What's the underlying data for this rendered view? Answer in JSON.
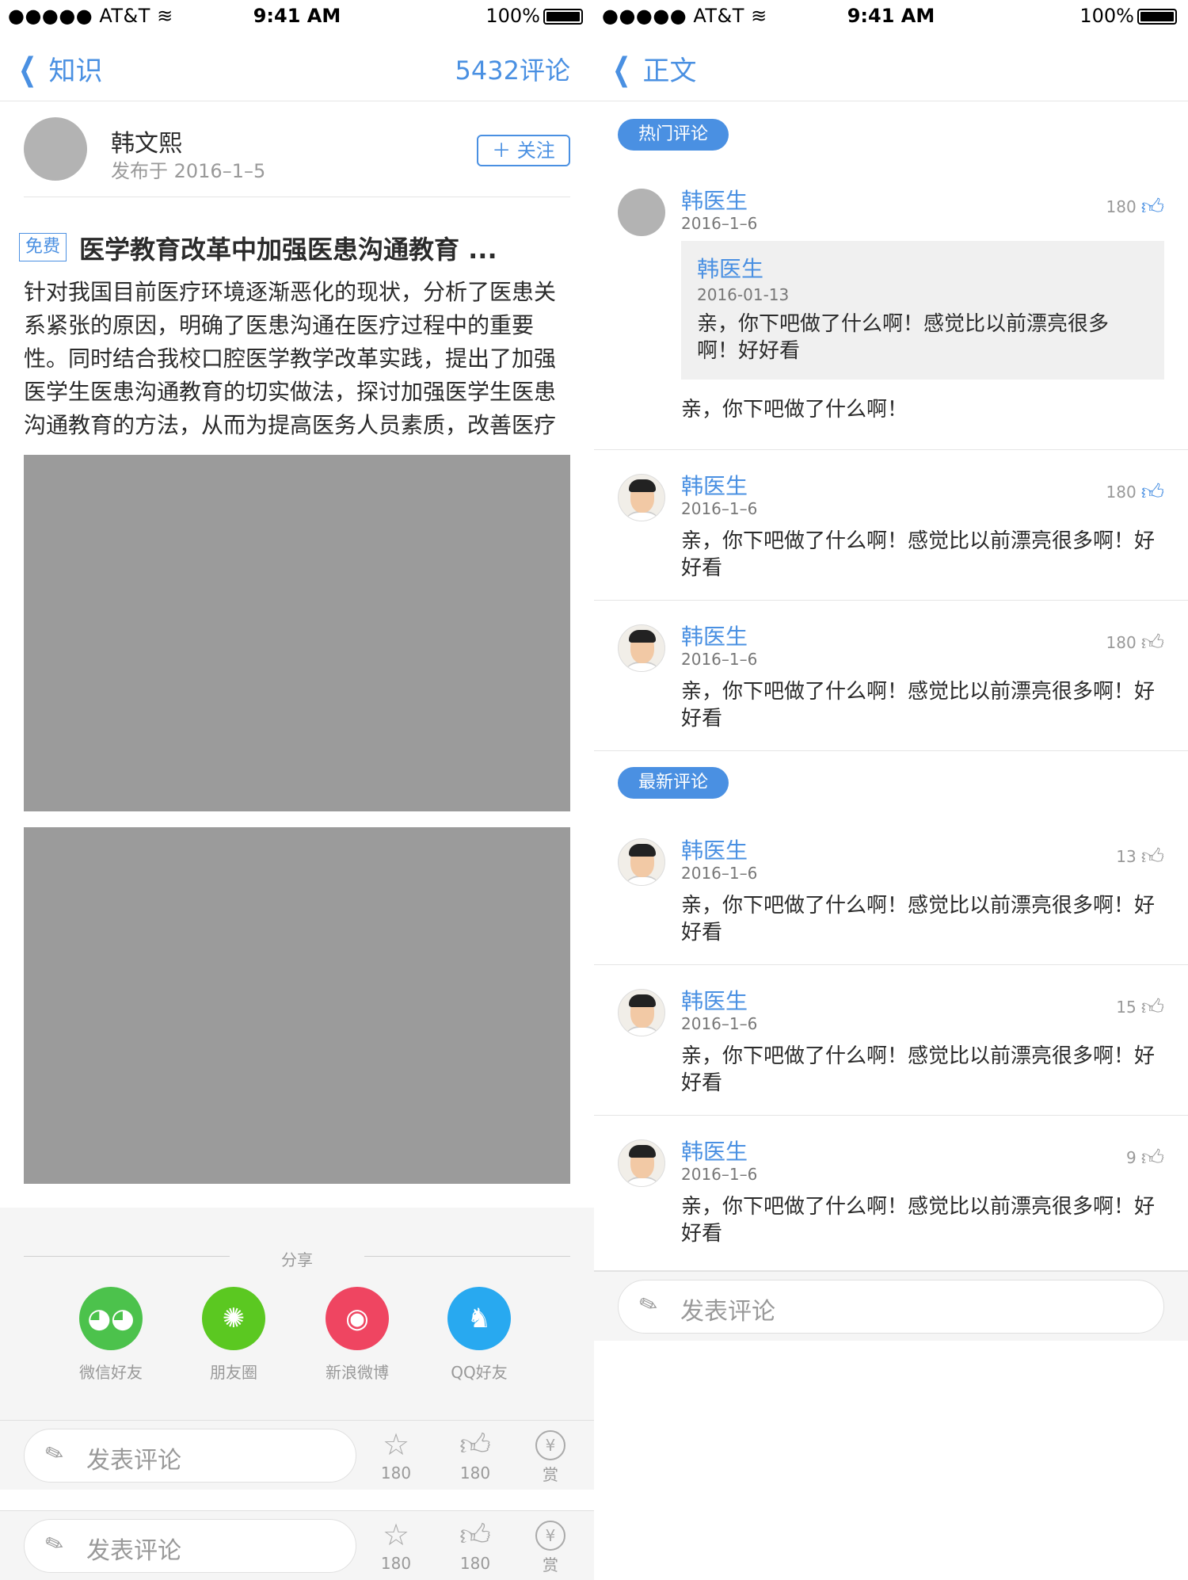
{
  "status_bar": {
    "carrier": "●●●●● AT&T",
    "wifi_icon": "wifi-icon",
    "time": "9:41 AM",
    "battery": "100%"
  },
  "left": {
    "nav": {
      "back_label": "知识",
      "right_label": "5432评论"
    },
    "author": {
      "name": "韩文熙",
      "date": "发布于 2016–1–5",
      "follow": "＋ 关注"
    },
    "title": {
      "tag": "免费",
      "text": "医学教育改革中加强医患沟通教育 ..."
    },
    "summary": "针对我国目前医疗环境逐渐恶化的现状，分析了医患关系紧张的原因，明确了医患沟通在医疗过程中的重要性。同时结合我校口腔医学教学改革实践，提出了加强医学生医患沟通教育的切实做法，探讨加强医学生医患沟通教育的方法，从而为提高医务人员素质，改善医疗环境提供了新",
    "share": {
      "label": "分享",
      "items": [
        {
          "label": "微信好友",
          "icon": "wechat-icon",
          "color": "#4cc24c"
        },
        {
          "label": "朋友圈",
          "icon": "moments-icon",
          "color": "#5bc821"
        },
        {
          "label": "新浪微博",
          "icon": "weibo-icon",
          "color": "#ef4561"
        },
        {
          "label": "QQ好友",
          "icon": "qq-icon",
          "color": "#28a9f0"
        }
      ]
    },
    "bottom_bar": {
      "placeholder": "发表评论",
      "star_count": "180",
      "like_count": "180",
      "reward_label": "赏"
    }
  },
  "right": {
    "nav": {
      "back_label": "正文"
    },
    "hot_label": "热门评论",
    "new_label": "最新评论",
    "hot_comments": [
      {
        "name": "韩医生",
        "date": "2016–1–6",
        "likes": "180",
        "liked": true,
        "quote": {
          "name": "韩医生",
          "date": "2016-01-13",
          "text": "亲，你下吧做了什么啊！感觉比以前漂亮很多啊！好好看"
        },
        "text": "亲，你下吧做了什么啊！"
      },
      {
        "name": "韩医生",
        "date": "2016–1–6",
        "likes": "180",
        "liked": true,
        "text": "亲，你下吧做了什么啊！感觉比以前漂亮很多啊！好好看"
      },
      {
        "name": "韩医生",
        "date": "2016–1–6",
        "likes": "180",
        "liked": false,
        "text": "亲，你下吧做了什么啊！感觉比以前漂亮很多啊！好好看"
      }
    ],
    "new_comments": [
      {
        "name": "韩医生",
        "date": "2016–1–6",
        "likes": "13",
        "text": "亲，你下吧做了什么啊！感觉比以前漂亮很多啊！好好看"
      },
      {
        "name": "韩医生",
        "date": "2016–1–6",
        "likes": "15",
        "text": "亲，你下吧做了什么啊！感觉比以前漂亮很多啊！好好看"
      },
      {
        "name": "韩医生",
        "date": "2016–1–6",
        "likes": "9",
        "text": "亲，你下吧做了什么啊！感觉比以前漂亮很多啊！好好看"
      }
    ],
    "bottom_bar": {
      "placeholder": "发表评论"
    }
  },
  "colors": {
    "accent": "#4a90e2",
    "text": "#2b2b2b",
    "meta": "#999999",
    "secondary": "#777777",
    "image_placeholder": "#9b9b9b",
    "panel": "#f5f5f5"
  }
}
